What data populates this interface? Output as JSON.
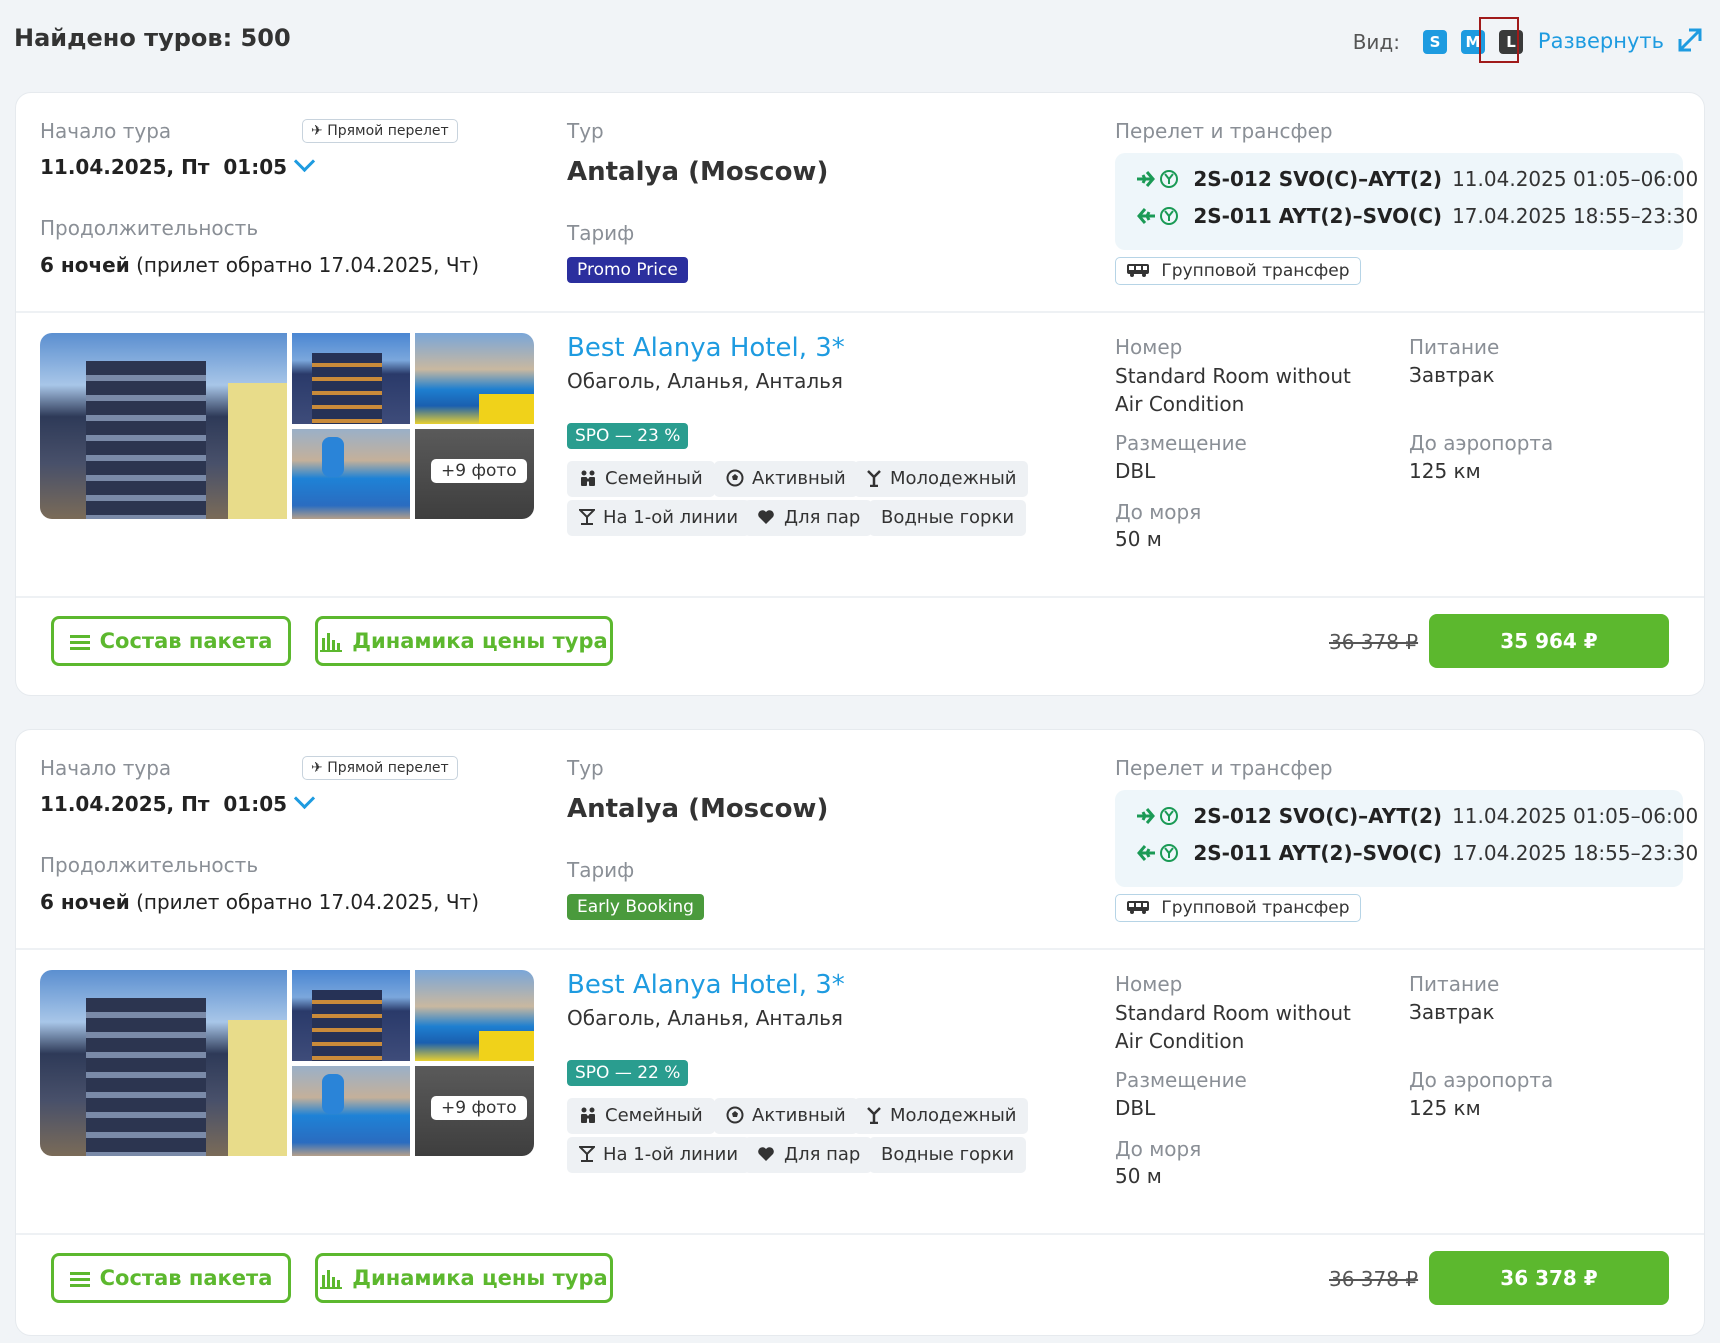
{
  "header": {
    "found_label": "Найдено туров: 500",
    "view_label": "Вид:",
    "view_options": [
      "S",
      "M",
      "L"
    ],
    "view_selected": "L",
    "expand_label": "Развернуть"
  },
  "colors": {
    "accent": "#1e9be0",
    "green": "#5cb82e",
    "flight_green": "#1a9a55",
    "promo": "#2b2f9e",
    "early_booking": "#4a9a3c",
    "spo": "#2a9d8f"
  },
  "cards": [
    {
      "start_label": "Начало тура",
      "direct_badge": "Прямой перелет",
      "start_date": "11.04.2025, Пт",
      "start_time": "01:05",
      "duration_label": "Продолжительность",
      "duration_nights": "6 ночей",
      "duration_return": "(прилет обратно 17.04.2025, Чт)",
      "tour_label": "Тур",
      "tour_name": "Antalya (Moscow)",
      "tariff_label": "Тариф",
      "tariff": "Promo Price",
      "flight_label": "Перелет и трансфер",
      "flights": [
        {
          "code": "2S-012 SVO(C)–AYT(2)",
          "date": "11.04.2025 01:05–06:00"
        },
        {
          "code": "2S-011 AYT(2)–SVO(C)",
          "date": "17.04.2025 18:55–23:30"
        }
      ],
      "transfer": "Групповой трансфер",
      "hotel_name": "Best Alanya Hotel, 3*",
      "hotel_location": "Обаголь, Аланья, Анталья",
      "more_photos": "+9 фото",
      "spo": "SPO — 23 %",
      "tags": [
        "Семейный",
        "Активный",
        "Молодежный",
        "На 1-ой линии",
        "Для пар",
        "Водные горки"
      ],
      "room_label": "Номер",
      "room_value": "Standard Room without Air Condition",
      "meal_label": "Питание",
      "meal_value": "Завтрак",
      "placement_label": "Размещение",
      "placement_value": "DBL",
      "airport_label": "До аэропорта",
      "airport_value": "125 км",
      "sea_label": "До моря",
      "sea_value": "50 м",
      "package_button": "Состав пакета",
      "dynamics_button": "Динамика цены тура",
      "old_price": "36 378 ₽",
      "price": "35 964 ₽"
    },
    {
      "start_label": "Начало тура",
      "direct_badge": "Прямой перелет",
      "start_date": "11.04.2025, Пт",
      "start_time": "01:05",
      "duration_label": "Продолжительность",
      "duration_nights": "6 ночей",
      "duration_return": "(прилет обратно 17.04.2025, Чт)",
      "tour_label": "Тур",
      "tour_name": "Antalya (Moscow)",
      "tariff_label": "Тариф",
      "tariff": "Early Booking",
      "flight_label": "Перелет и трансфер",
      "flights": [
        {
          "code": "2S-012 SVO(C)–AYT(2)",
          "date": "11.04.2025 01:05–06:00"
        },
        {
          "code": "2S-011 AYT(2)–SVO(C)",
          "date": "17.04.2025 18:55–23:30"
        }
      ],
      "transfer": "Групповой трансфер",
      "hotel_name": "Best Alanya Hotel, 3*",
      "hotel_location": "Обаголь, Аланья, Анталья",
      "more_photos": "+9 фото",
      "spo": "SPO — 22 %",
      "tags": [
        "Семейный",
        "Активный",
        "Молодежный",
        "На 1-ой линии",
        "Для пар",
        "Водные горки"
      ],
      "room_label": "Номер",
      "room_value": "Standard Room without Air Condition",
      "meal_label": "Питание",
      "meal_value": "Завтрак",
      "placement_label": "Размещение",
      "placement_value": "DBL",
      "airport_label": "До аэропорта",
      "airport_value": "125 км",
      "sea_label": "До моря",
      "sea_value": "50 м",
      "package_button": "Состав пакета",
      "dynamics_button": "Динамика цены тура",
      "old_price": "36 378 ₽",
      "price": "36 378 ₽"
    }
  ]
}
